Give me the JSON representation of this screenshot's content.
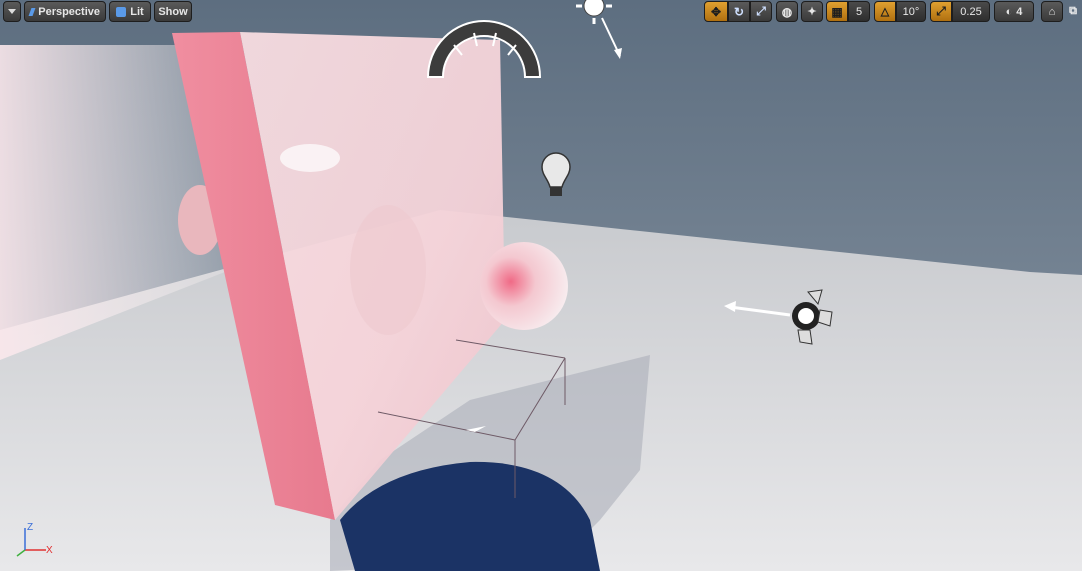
{
  "toolbar_left": {
    "menu_icon": "chevron-down-icon",
    "view_mode": "Perspective",
    "lighting_mode": "Lit",
    "show_label": "Show"
  },
  "toolbar_right": {
    "grid_snap_value": "5",
    "rotation_snap_value": "10°",
    "scale_snap_value": "0.25",
    "camera_speed_value": "4"
  },
  "axis_gizmo": {
    "z_label": "Z",
    "x_label": "X"
  },
  "scene_objects": [
    "directional-light-icon",
    "skylight-icon",
    "point-light-icon",
    "spot-light-icon",
    "pink-wall-mesh",
    "pink-sphere-mesh",
    "floor-plane"
  ],
  "colors": {
    "accent_orange": "#d89a2a",
    "sky": "#7c8b9a",
    "floor": "#d9dade",
    "wall": "#f2cfd5",
    "shadow": "#1b3365"
  }
}
